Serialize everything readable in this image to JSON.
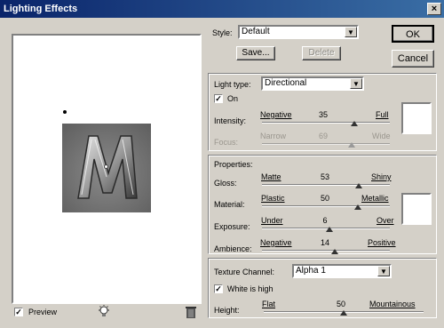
{
  "window": {
    "title": "Lighting Effects",
    "close_glyph": "×"
  },
  "style": {
    "label": "Style:",
    "value": "Default",
    "save": "Save...",
    "delete": "Delete"
  },
  "buttons": {
    "ok": "OK",
    "cancel": "Cancel"
  },
  "light": {
    "type_label": "Light type:",
    "type_value": "Directional",
    "on_label": "On",
    "on_checked": true,
    "intensity": {
      "label": "Intensity:",
      "min": "Negative",
      "max": "Full",
      "value": "35",
      "fraction": 0.72
    },
    "focus": {
      "label": "Focus:",
      "min": "Narrow",
      "max": "Wide",
      "value": "69",
      "fraction": 0.7,
      "disabled": true
    },
    "color": "#ffffff"
  },
  "properties": {
    "title": "Properties:",
    "gloss": {
      "label": "Gloss:",
      "min": "Matte",
      "max": "Shiny",
      "value": "53",
      "fraction": 0.76
    },
    "material": {
      "label": "Material:",
      "min": "Plastic",
      "max": "Metallic",
      "value": "50",
      "fraction": 0.75
    },
    "exposure": {
      "label": "Exposure:",
      "min": "Under",
      "max": "Over",
      "value": "6",
      "fraction": 0.53
    },
    "ambience": {
      "label": "Ambience:",
      "min": "Negative",
      "max": "Positive",
      "value": "14",
      "fraction": 0.57
    },
    "color": "#ffffff"
  },
  "texture": {
    "channel_label": "Texture Channel:",
    "channel_value": "Alpha 1",
    "white_high_label": "White is high",
    "white_high_checked": true,
    "height": {
      "label": "Height:",
      "min": "Flat",
      "max": "Mountainous",
      "value": "50",
      "fraction": 0.5
    }
  },
  "preview": {
    "label": "Preview",
    "checked": true,
    "letter": "M",
    "light_icon": "lightbulb-icon",
    "trash_icon": "trash-icon"
  }
}
